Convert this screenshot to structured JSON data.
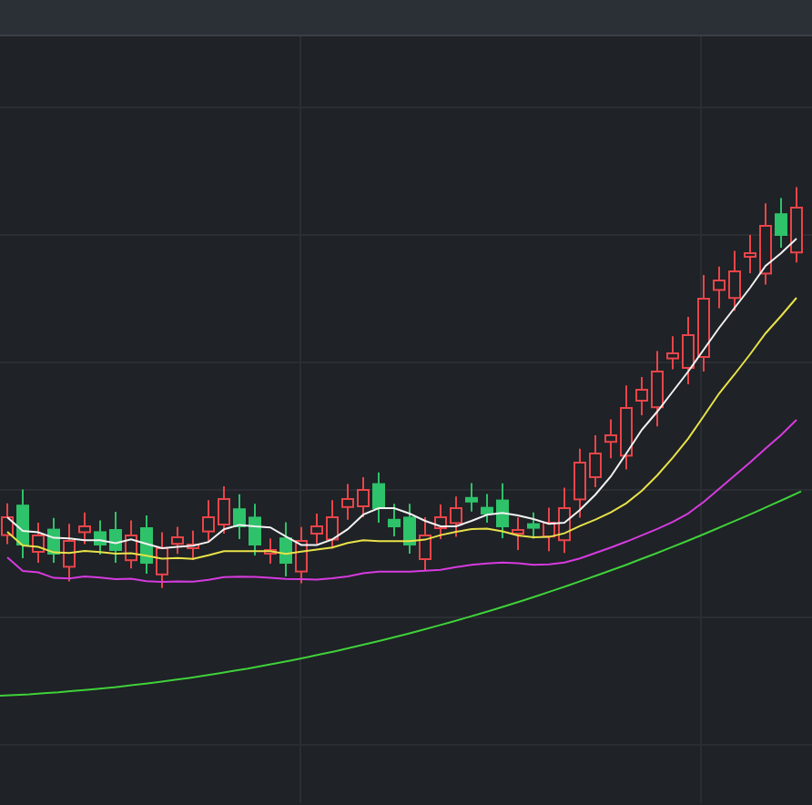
{
  "chart": {
    "moving_averages": true
  }
}
